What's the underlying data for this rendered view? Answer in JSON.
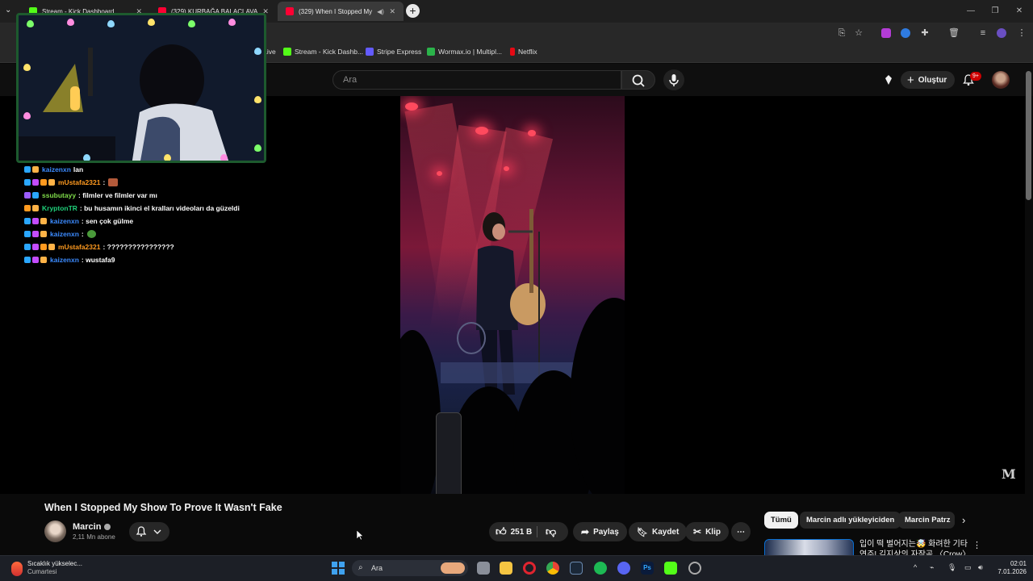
{
  "browser": {
    "tabs": [
      {
        "title": "Stream - Kick Dashboard",
        "favicon_color": "#53fc18"
      },
      {
        "title": "(329) KURBAĞA BALACLAVA",
        "favicon_color": "#ff0033"
      },
      {
        "title": "(329) When I Stopped My",
        "favicon_color": "#ff0033"
      }
    ],
    "new_tab_label": "+",
    "bookmarks": [
      {
        "label": "DLive",
        "color": "#ffd300"
      },
      {
        "label": "Stream - Kick Dashb...",
        "color": "#53fc18"
      },
      {
        "label": "Stripe Express",
        "color": "#635bff"
      },
      {
        "label": "Wormax.io | Multipl...",
        "color": "#2bb34a"
      },
      {
        "label": "Netflix",
        "color": "#e50914"
      }
    ]
  },
  "youtube": {
    "search_placeholder": "Ara",
    "create_label": "Oluştur",
    "notifications_badge": "9+",
    "video_title": "When I Stopped My Show To Prove It Wasn't Fake",
    "channel_name": "Marcin",
    "subscribers": "2,11 Mn abone",
    "like_count": "251 B",
    "actions": {
      "share": "Paylaş",
      "save": "Kaydet",
      "clip": "Klip",
      "more": "⋯"
    },
    "watermark": "M",
    "chips": [
      "Tümü",
      "Marcin adlı yükleyiciden",
      "Marcin Patrz"
    ],
    "recommendation_title": "입이 떡 벌어지는🤯 화려한 기타 연주! 김지상의 자작곡 〈Crow〉"
  },
  "chat": [
    {
      "user": "kaizenxn",
      "message": "lan",
      "color": "#3c8bff"
    },
    {
      "user": "mUstafa2321",
      "message": ":",
      "color": "#ff9a1f",
      "emote": true
    },
    {
      "user": "ssubutayy",
      "message": ": filmler ve filmler var mı",
      "color": "#7fdc4a"
    },
    {
      "user": "KryptonTR",
      "message": ": bu husamın ikinci el kralları videoları da güzeldi",
      "color": "#1fd07a"
    },
    {
      "user": "kaizenxn",
      "message": ": sen çok gülme",
      "color": "#3c8bff"
    },
    {
      "user": "kaizenxn",
      "message": ":",
      "color": "#3c8bff",
      "emote": true
    },
    {
      "user": "mUstafa2321",
      "message": ": ????????????????",
      "color": "#ff9a1f"
    },
    {
      "user": "kaizenxn",
      "message": ": wustafa9",
      "color": "#3c8bff"
    }
  ],
  "taskbar": {
    "weather_title": "Sıcaklık yükselec...",
    "weather_sub": "Cumartesi",
    "search_label": "Ara",
    "time": "02:01",
    "date": "7.01.2026"
  }
}
